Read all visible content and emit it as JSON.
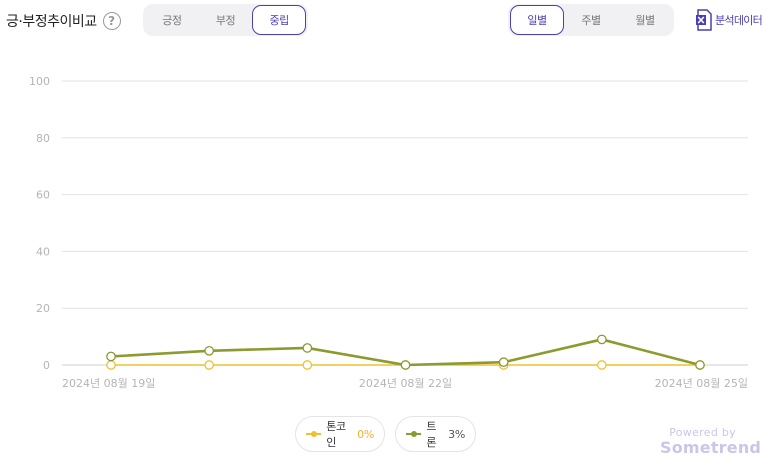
{
  "header": {
    "title": "긍·부정추이비교",
    "help_icon": "?"
  },
  "sentiment_tabs": [
    {
      "label": "긍정",
      "active": false
    },
    {
      "label": "부정",
      "active": false
    },
    {
      "label": "중립",
      "active": true
    }
  ],
  "period_tabs": [
    {
      "label": "일별",
      "active": true
    },
    {
      "label": "주별",
      "active": false
    },
    {
      "label": "월별",
      "active": false
    }
  ],
  "export": {
    "label": "분석데이터",
    "icon": "excel-icon"
  },
  "colors": {
    "accent": "#4a3fb3",
    "series_1": "#f0c030",
    "series_2": "#8c9a2f",
    "grid": "#e2e2e2",
    "axis_text": "#b5b5b5"
  },
  "legend": [
    {
      "name": "톤코인",
      "pct": "0%"
    },
    {
      "name": "트론",
      "pct": "3%"
    }
  ],
  "powered": {
    "by": "Powered by",
    "brand": "Sometrend"
  },
  "chart_data": {
    "type": "line",
    "title": "",
    "xlabel": "",
    "ylabel": "",
    "ylim": [
      0,
      100
    ],
    "yticks": [
      0,
      20,
      40,
      60,
      80,
      100
    ],
    "x": [
      "2024-08-19",
      "2024-08-20",
      "2024-08-21",
      "2024-08-22",
      "2024-08-23",
      "2024-08-24",
      "2024-08-25"
    ],
    "xtick_labels": [
      {
        "index": 0,
        "label": "2024년 08월 19일"
      },
      {
        "index": 3,
        "label": "2024년 08월 22일"
      },
      {
        "index": 6,
        "label": "2024년 08월 25일"
      }
    ],
    "grid": true,
    "legend_position": "bottom-center",
    "series": [
      {
        "name": "톤코인",
        "color": "#f0c030",
        "values": [
          0,
          0,
          0,
          0,
          0,
          0,
          0
        ]
      },
      {
        "name": "트론",
        "color": "#8c9a2f",
        "values": [
          3,
          5,
          6,
          0,
          1,
          9,
          0
        ]
      }
    ]
  }
}
